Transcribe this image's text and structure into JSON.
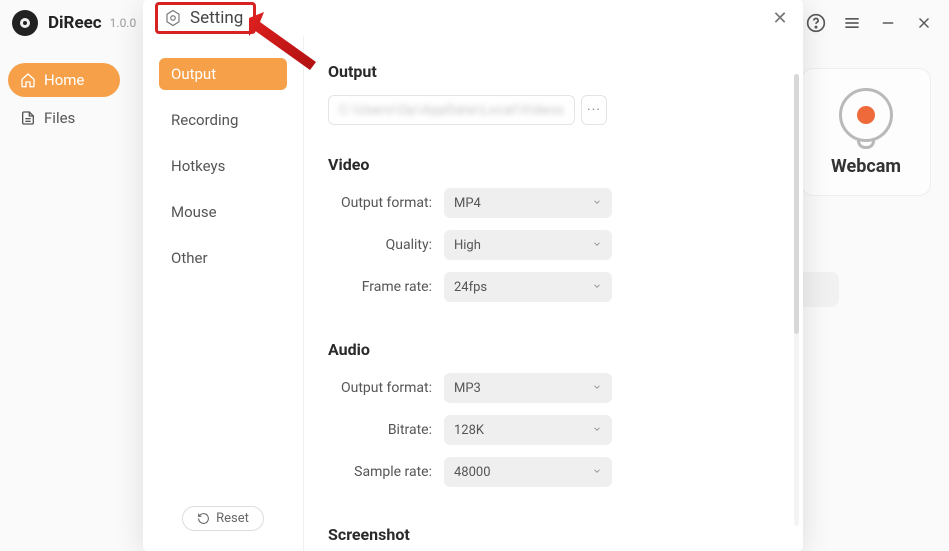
{
  "app": {
    "name": "DiReec",
    "version": "1.0.0"
  },
  "main_sidebar": {
    "items": [
      {
        "label": "Home",
        "active": true,
        "icon": "home"
      },
      {
        "label": "Files",
        "active": false,
        "icon": "file"
      }
    ]
  },
  "background": {
    "webcam_label": "Webcam"
  },
  "modal": {
    "title": "Setting",
    "close_icon": "✕",
    "nav_items": [
      {
        "label": "Output",
        "active": true
      },
      {
        "label": "Recording",
        "active": false
      },
      {
        "label": "Hotkeys",
        "active": false
      },
      {
        "label": "Mouse",
        "active": false
      },
      {
        "label": "Other",
        "active": false
      }
    ],
    "reset_label": "Reset",
    "sections": {
      "output": {
        "title": "Output",
        "path_value": "C:\\Users\\Op\\AppData\\Local\\Videos",
        "more_label": "···"
      },
      "video": {
        "title": "Video",
        "rows": [
          {
            "label": "Output format:",
            "value": "MP4"
          },
          {
            "label": "Quality:",
            "value": "High"
          },
          {
            "label": "Frame rate:",
            "value": "24fps"
          }
        ]
      },
      "audio": {
        "title": "Audio",
        "rows": [
          {
            "label": "Output format:",
            "value": "MP3"
          },
          {
            "label": "Bitrate:",
            "value": "128K"
          },
          {
            "label": "Sample rate:",
            "value": "48000"
          }
        ]
      },
      "screenshot": {
        "title": "Screenshot"
      }
    }
  }
}
